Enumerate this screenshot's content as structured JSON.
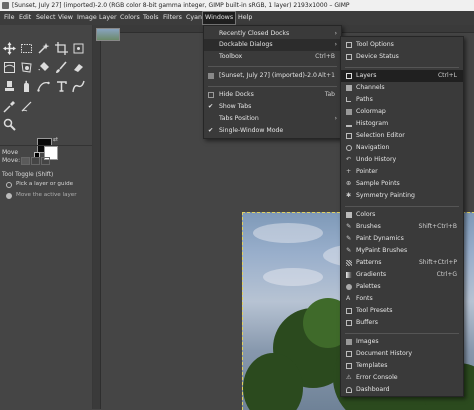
{
  "window": {
    "title": "[Sunset, July 27] (imported)-2.0 (RGB color 8-bit gamma integer, GIMP built-in sRGB, 1 layer) 2193x1000 – GIMP"
  },
  "menubar": [
    "File",
    "Edit",
    "Select",
    "View",
    "Image",
    "Layer",
    "Colors",
    "Tools",
    "Filters",
    "Cyan",
    "Windows",
    "Help"
  ],
  "tool_options": {
    "title": "Move",
    "mode_label": "Move:",
    "toggle_label": "Tool Toggle  (Shift)",
    "option1": "Pick a layer or guide",
    "option2": "Move the active layer"
  },
  "windows_menu": {
    "items": [
      {
        "label": "Recently Closed Docks",
        "accel": "",
        "submenu": true
      },
      {
        "label": "Dockable Dialogs",
        "accel": "",
        "submenu": true
      },
      {
        "label": "Toolbox",
        "accel": "Ctrl+B",
        "submenu": false
      },
      {
        "label": "[Sunset, July 27] (imported)-2.0",
        "accel": "Alt+1",
        "submenu": false
      },
      {
        "label": "Hide Docks",
        "accel": "Tab",
        "submenu": false
      },
      {
        "label": "Show Tabs",
        "accel": "",
        "submenu": false
      },
      {
        "label": "Tabs Position",
        "accel": "",
        "submenu": true
      },
      {
        "label": "Single-Window Mode",
        "accel": "",
        "submenu": false
      }
    ]
  },
  "dockable_menu": {
    "items": [
      {
        "label": "Tool Options",
        "accel": ""
      },
      {
        "label": "Device Status",
        "accel": ""
      },
      {
        "label": "Layers",
        "accel": "Ctrl+L"
      },
      {
        "label": "Channels",
        "accel": ""
      },
      {
        "label": "Paths",
        "accel": ""
      },
      {
        "label": "Colormap",
        "accel": ""
      },
      {
        "label": "Histogram",
        "accel": ""
      },
      {
        "label": "Selection Editor",
        "accel": ""
      },
      {
        "label": "Navigation",
        "accel": ""
      },
      {
        "label": "Undo History",
        "accel": ""
      },
      {
        "label": "Pointer",
        "accel": ""
      },
      {
        "label": "Sample Points",
        "accel": ""
      },
      {
        "label": "Symmetry Painting",
        "accel": ""
      },
      {
        "label": "Colors",
        "accel": ""
      },
      {
        "label": "Brushes",
        "accel": "Shift+Ctrl+B"
      },
      {
        "label": "Paint Dynamics",
        "accel": ""
      },
      {
        "label": "MyPaint Brushes",
        "accel": ""
      },
      {
        "label": "Patterns",
        "accel": "Shift+Ctrl+P"
      },
      {
        "label": "Gradients",
        "accel": "Ctrl+G"
      },
      {
        "label": "Palettes",
        "accel": ""
      },
      {
        "label": "Fonts",
        "accel": ""
      },
      {
        "label": "Tool Presets",
        "accel": ""
      },
      {
        "label": "Buffers",
        "accel": ""
      },
      {
        "label": "Images",
        "accel": ""
      },
      {
        "label": "Document History",
        "accel": ""
      },
      {
        "label": "Templates",
        "accel": ""
      },
      {
        "label": "Error Console",
        "accel": ""
      },
      {
        "label": "Dashboard",
        "accel": ""
      }
    ]
  },
  "colors": {
    "foreground": "#0a0a0a",
    "background": "#ffffff",
    "selection_outline": "#e0d060"
  }
}
